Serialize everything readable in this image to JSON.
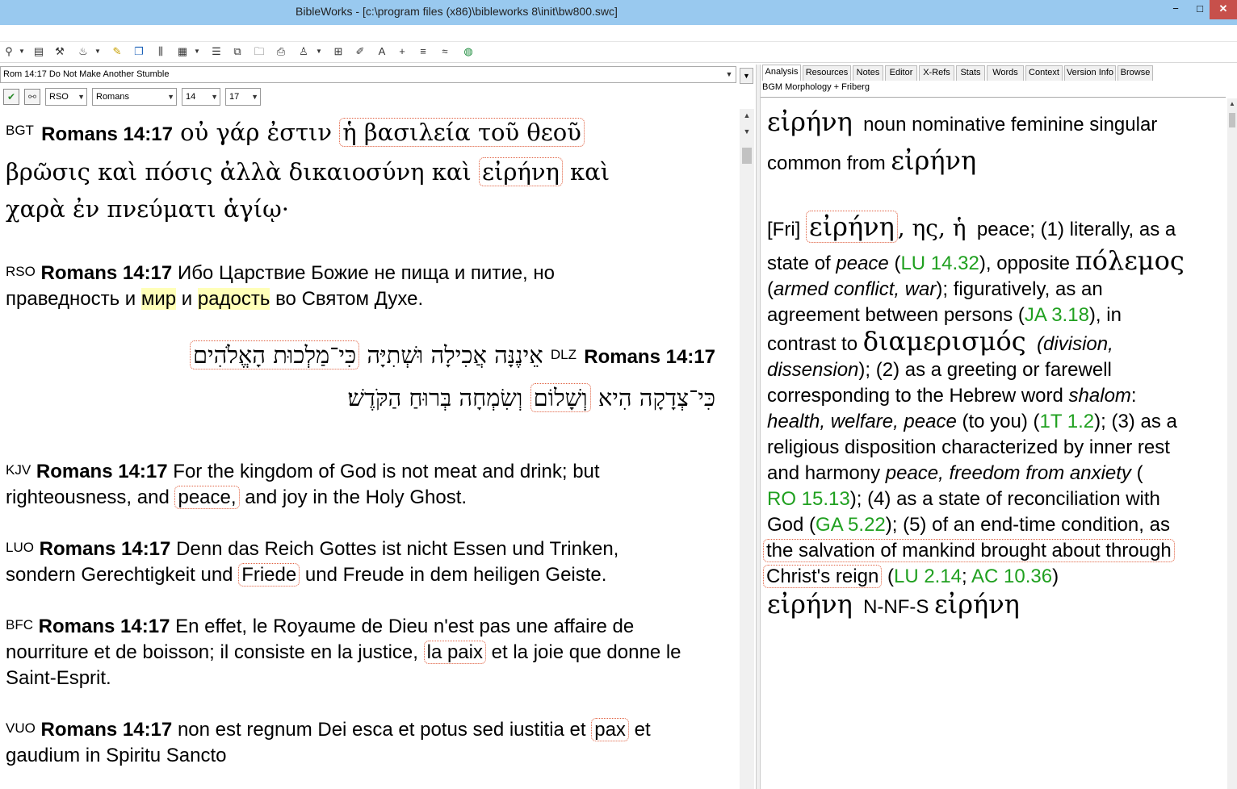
{
  "window": {
    "title": "BibleWorks - [c:\\program files (x86)\\bibleworks 8\\init\\bw800.swc]",
    "min": "−",
    "max": "□",
    "close": "✕"
  },
  "colors": {
    "titlebar": "#99c9ef",
    "close": "#c7504b",
    "link": "#20a020",
    "highlight": "#ffffb8",
    "box": "#e06040"
  },
  "left": {
    "verse_ref": "Rom 14:17 Do Not Make Another Stumble",
    "version_select": "RSO",
    "book_select": "Romans",
    "chapter_select": "14",
    "verse_select": "17",
    "verses": [
      {
        "abbr": "BGT",
        "ref": "Romans 14:17",
        "t1": "οὐ γάρ ἐστιν",
        "b1": "ἡ βασιλεία τοῦ θεοῦ",
        "t2": "βρῶσις καὶ πόσις ἀλλὰ δικαιοσύνη καὶ",
        "b2": "εἰρήνη",
        "t3": "καὶ",
        "t4": "χαρὰ ἐν πνεύματι ἁγίῳ·"
      },
      {
        "abbr": "RSO",
        "ref": "Romans 14:17",
        "t1": "Ибо Царствие Божие не пища и питие, но",
        "t2": "праведность и",
        "h1": "мир",
        "t3": "и",
        "h2": "радость",
        "t4": "во Святом Духе."
      },
      {
        "abbr": "DLZ",
        "ref": "Romans 14:17",
        "b1": "כִּי־מַלְכוּת הָאֱלֹהִים",
        "t1": "אֵינֶנָּה אֲכִילָה וּשְׁתִיָּה",
        "t2": "כִּי־צְדָקָה הִיא",
        "b2": "וְשָׁלוֹם",
        "t3": "וְשִׂמְחָה בְּרוּחַ הַקֹּדֶשׁ׃"
      },
      {
        "abbr": "KJV",
        "ref": "Romans 14:17",
        "t1": "For the kingdom of God is not meat and drink; but",
        "t2": "righteousness, and",
        "b1": "peace,",
        "t3": "and joy in the Holy Ghost."
      },
      {
        "abbr": "LUO",
        "ref": "Romans 14:17",
        "t1": "Denn das Reich Gottes ist nicht Essen und Trinken,",
        "t2": "sondern Gerechtigkeit und",
        "b1": "Friede",
        "t3": "und Freude in dem heiligen Geiste."
      },
      {
        "abbr": "BFC",
        "ref": "Romans 14:17",
        "t1": "En effet, le Royaume de Dieu n'est pas une affaire de",
        "t2": "nourriture et de boisson; il consiste en la justice,",
        "b1": "la paix",
        "t3": "et la joie que donne le",
        "t4": "Saint-Esprit."
      },
      {
        "abbr": "VUO",
        "ref": "Romans 14:17",
        "t1": "non est regnum Dei esca et potus sed iustitia et",
        "b1": "pax",
        "t2": "et",
        "t3": "gaudium in Spiritu Sancto"
      }
    ]
  },
  "right": {
    "tabs": [
      "Analysis",
      "Resources",
      "Notes",
      "Editor",
      "X-Refs",
      "Stats",
      "Words",
      "Context",
      "Version Info",
      "Browse"
    ],
    "active_tab": "Analysis",
    "label": "BGM Morphology + Friberg",
    "lemma": "εἰρήνη",
    "parse": "noun nominative feminine singular",
    "common_from": "common from",
    "lemma2": "εἰρήνη",
    "fri_tag": "[Fri]",
    "fri_word": "εἰρήνη",
    "fri_gen": ", ης, ἡ",
    "d1": "peace; (1) literally, as a",
    "d2a": "state of",
    "d2b": "peace",
    "d2c": "(",
    "l1": "LU 14.32",
    "d2d": "), opposite",
    "d2g": "πόλεμος",
    "d3a": "(",
    "d3b": "armed conflict, war",
    "d3c": "); figuratively, as an",
    "d4a": "agreement between persons (",
    "l2": "JA 3.18",
    "d4b": "), in",
    "d5a": "contrast to",
    "d5g": "διαμερισμός",
    "d5b": "(division,",
    "d6a": "dissension",
    "d6b": "); (2) as a greeting or farewell",
    "d7a": "corresponding to the Hebrew word",
    "d7b": "shalom",
    "d7c": ":",
    "d8a": "health, welfare, peace",
    "d8b": "(to you) (",
    "l3": "1T 1.2",
    "d8c": "); (3) as a",
    "d9": "religious disposition characterized by inner rest",
    "d10a": "and harmony",
    "d10b": "peace, freedom from anxiety",
    "d10c": "(",
    "l4": "RO 15.13",
    "d11": "); (4) as a state of reconciliation with",
    "d12a": "God (",
    "l5": "GA 5.22",
    "d12b": "); (5) of an end-time condition, as",
    "d13": "the salvation of mankind brought about through",
    "d14a": "Christ's reign",
    "d14b": "(",
    "l6": "LU 2.14",
    "d14c": ";",
    "l7": "AC 10.36",
    "d14d": ")",
    "bgm_word": "εἰρήνη",
    "bgm_code": "N-NF-S",
    "bgm_lemma": "εἰρήνη"
  }
}
